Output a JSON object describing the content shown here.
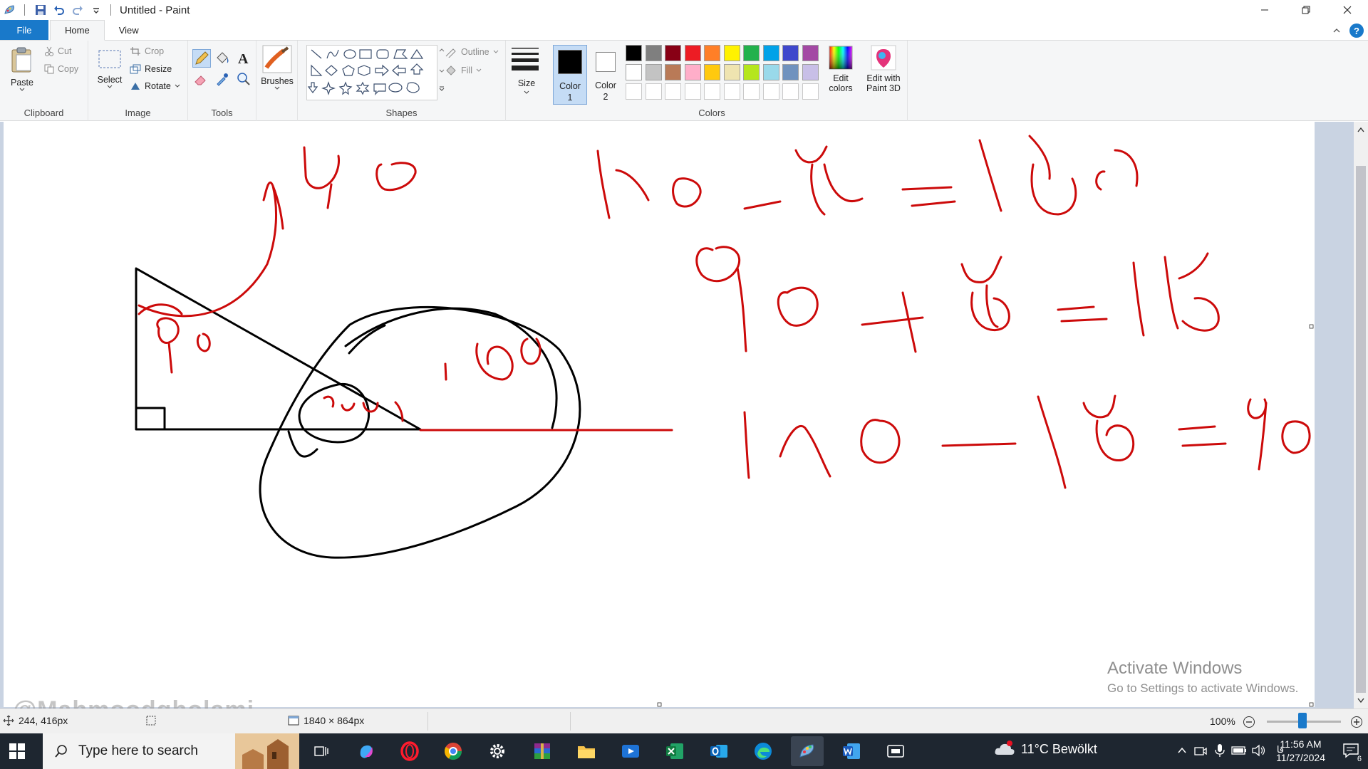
{
  "window": {
    "title": "Untitled - Paint"
  },
  "tabs": [
    {
      "label": "File"
    },
    {
      "label": "Home"
    },
    {
      "label": "View"
    }
  ],
  "ribbon": {
    "clipboard": {
      "paste": "Paste",
      "cut": "Cut",
      "copy": "Copy",
      "group": "Clipboard"
    },
    "image": {
      "select": "Select",
      "crop": "Crop",
      "resize": "Resize",
      "rotate": "Rotate",
      "group": "Image"
    },
    "tools": {
      "group": "Tools"
    },
    "brushes": {
      "label": "Brushes"
    },
    "shapes": {
      "outline": "Outline",
      "fill": "Fill",
      "group": "Shapes"
    },
    "size": {
      "label": "Size"
    },
    "color1": {
      "label": "Color",
      "num": "1"
    },
    "color2": {
      "label": "Color",
      "num": "2"
    },
    "colors": {
      "group": "Colors",
      "edit": "Edit",
      "edit2": "colors"
    },
    "paint3d": {
      "line1": "Edit with",
      "line2": "Paint 3D"
    },
    "palette_row1": [
      "#000000",
      "#7f7f7f",
      "#880015",
      "#ed1c24",
      "#ff7f27",
      "#fff200",
      "#22b14c",
      "#00a2e8",
      "#3f48cc",
      "#a349a4"
    ],
    "palette_row2": [
      "#ffffff",
      "#c3c3c3",
      "#b97a57",
      "#ffaec9",
      "#ffc90e",
      "#efe4b0",
      "#b5e61d",
      "#99d9ea",
      "#7092be",
      "#c8bfe7"
    ],
    "color1_value": "#000000",
    "color2_value": "#ffffff"
  },
  "canvas": {
    "drawing_color_black": "#000000",
    "drawing_color_red": "#cc0a0a"
  },
  "overlay": {
    "activate_title": "Activate Windows",
    "activate_sub": "Go to Settings to activate Windows.",
    "handle": "@Mahmoodgholami"
  },
  "statusbar": {
    "cursor_pos": "244, 416px",
    "canvas_size": "1840 × 864px",
    "zoom": "100%"
  },
  "taskbar": {
    "search_placeholder": "Type here to search",
    "weather": "11°C  Bewölkt",
    "time": "11:56 AM",
    "date": "11/27/2024",
    "lang": "فا",
    "notif_count": "6"
  }
}
